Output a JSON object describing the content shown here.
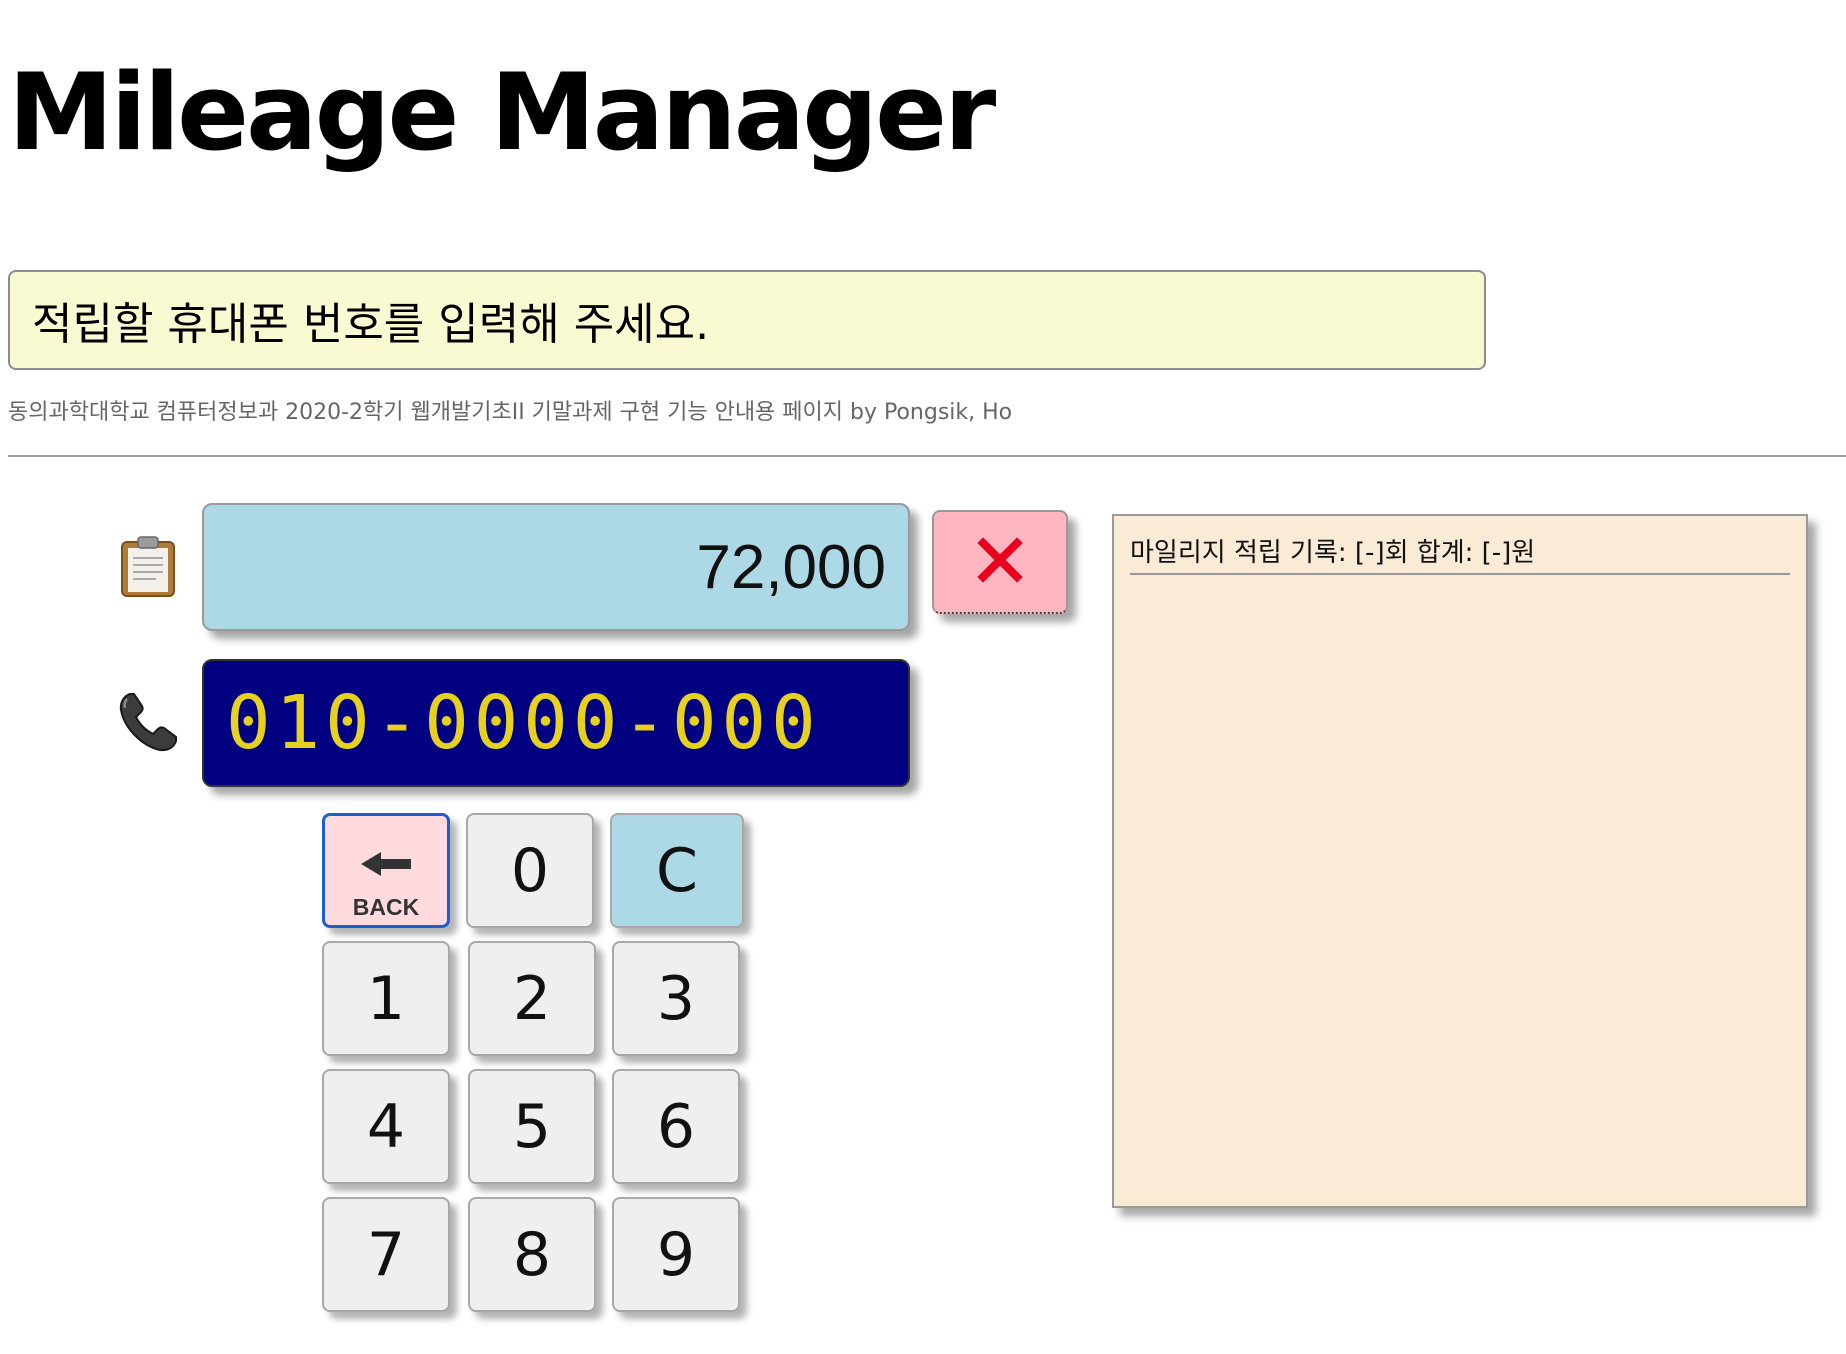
{
  "title": "Mileage Manager",
  "message": "적립할 휴대폰 번호를 입력해 주세요.",
  "credit": "동의과학대학교 컴퓨터정보과 2020-2학기 웹개발기초II 기말과제 구현 기능 안내용 페이지 by Pongsik, Ho",
  "amount": "72,000",
  "phone": "010-0000-000",
  "icons": {
    "amount": "clipboard-icon",
    "phone": "telephone-icon",
    "close": "close-icon",
    "back": "back-arrow-icon"
  },
  "keypad": {
    "back_label": "BACK",
    "zero": "0",
    "clear": "C",
    "one": "1",
    "two": "2",
    "three": "3",
    "four": "4",
    "five": "5",
    "six": "6",
    "seven": "7",
    "eight": "8",
    "nine": "9"
  },
  "history": {
    "header": "마일리지 적립 기록: [-]회 합계: [-]원"
  },
  "colors": {
    "message_bg": "#fafad2",
    "amount_bg": "#add8e6",
    "close_bg": "#ffb6c1",
    "close_x": "#e8001c",
    "phone_bg": "#000080",
    "phone_text": "#e6d21e",
    "key_bg": "#efefef",
    "back_bg": "#ffdbe0",
    "back_border": "#1a5fd0",
    "clear_bg": "#add8e6",
    "history_bg": "#faebd7"
  }
}
